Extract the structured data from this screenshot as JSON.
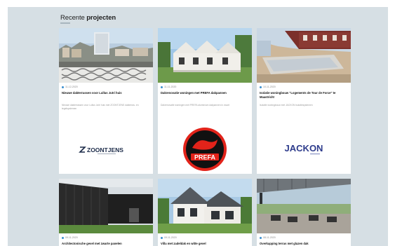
{
  "section": {
    "title_prefix": "Recente",
    "title_bold": "projecten"
  },
  "cards": [
    {
      "date": "11-12-2020",
      "title": "Nieuwe dakterrassen voor Lullus Jutri huis",
      "desc": "Nieuwe dakterrassen voor Lullus Jutri huis met ZOONTJENS dakterras- en tegelsystemen",
      "logo": "ZOONTJENS"
    },
    {
      "date": "11-11-2020",
      "title": "Dakrenovatie woningen met PREFA dakpannen",
      "desc": "Dakrenovatie woningen met PREFA aluminium dakpannen in zwart",
      "logo": "PREFA"
    },
    {
      "date": "10-11-2020",
      "title": "Isolatie woningbouw \"Logements de Tour de Force\" te Maastricht",
      "desc": "Isolatie woningbouw met JACKON isolatiesystemen",
      "logo": "JACKON"
    },
    {
      "date": "09-11-2020",
      "title": "Architectonische gevel met zwarte panelen",
      "desc": "",
      "logo": ""
    },
    {
      "date": "09-11-2020",
      "title": "Villa met zadeldak en witte gevel",
      "desc": "",
      "logo": ""
    },
    {
      "date": "08-11-2020",
      "title": "Overkapping terras met glazen dak",
      "desc": "",
      "logo": ""
    }
  ],
  "colors": {
    "background": "#d6dfe4",
    "accent_dot": "#3a8fd0",
    "prefa_red": "#e2231a",
    "jackon_blue": "#2e3c8c"
  }
}
